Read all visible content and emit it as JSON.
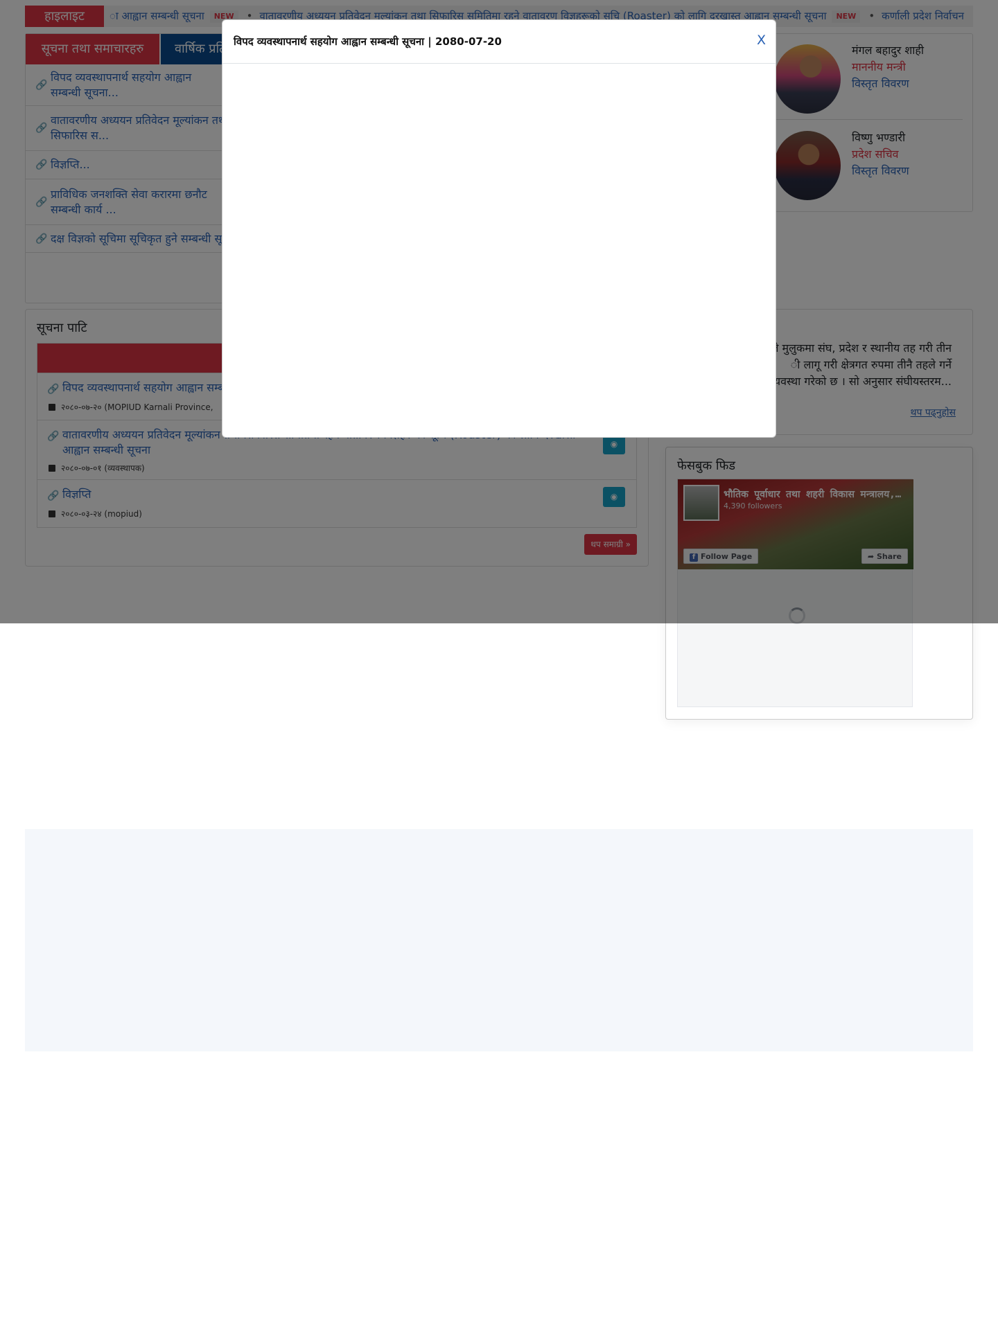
{
  "ticker": {
    "label": "हाइलाइट",
    "items": [
      {
        "text": "ा आह्वान सम्बन्धी सूचना",
        "badge": "NEW"
      },
      {
        "text": "वातावरणीय अध्ययन प्रतिवेदन मूल्यांकन तथा सिफारिस समितिमा रहने वातावरण विज्ञहरूको सूचि (Roaster) को लागि दरखास्त आह्वान सम्बन्धी सूचना",
        "badge": "NEW"
      },
      {
        "text": "कर्णाली प्रदेश निर्वाचन"
      }
    ]
  },
  "tabs": [
    {
      "label": "सूचना तथा समाचारहरु"
    },
    {
      "label": "वार्षिक प्रति"
    }
  ],
  "news": [
    {
      "text": "विपद व्यवस्थापनार्थ सहयोग आह्वान सम्बन्धी सूचना..."
    },
    {
      "text": "वातावरणीय अध्ययन प्रतिवेदन मूल्यांकन तथा सिफारिस स..."
    },
    {
      "text": "विज्ञप्ति..."
    },
    {
      "text": "प्राविधिक जनशक्ति सेवा करारमा छनौट सम्बन्धी कार्य ..."
    },
    {
      "text": "दक्ष विज्ञको सूचिमा सूचिकृत हुने सम्बन्धी सूचना"
    }
  ],
  "notice_board": {
    "title": "सूचना पाटि",
    "rows": [
      {
        "title": "विपद व्यवस्थापनार्थ सहयोग आह्वान सम्बन्धी सूचना",
        "meta": "२०८०-०७-२० (MOPIUD Karnali Province,"
      },
      {
        "title": "वातावरणीय अध्ययन प्रतिवेदन मूल्यांकन तथा सिफारिस समितिमा रहने वातावरण विज्ञहरूको सूचि (Roaster) को लागि दरखास्त आह्वान सम्बन्धी सूचना",
        "meta": "२०८०-०७-०१ (व्यवस्थापक)"
      },
      {
        "title": "विज्ञप्ति",
        "meta": "२०८०-०३-२४ (mopiud)"
      }
    ],
    "more_label": "थप समाग्री »"
  },
  "officials": [
    {
      "name": "मंगल बहादुर शाही",
      "role": "माननीय मन्त्री",
      "link": "विस्तृत विवरण"
    },
    {
      "name": "विष्णु भण्डारी",
      "role": "प्रदेश सचिव",
      "link": "विस्तृत विवरण"
    }
  ],
  "about": {
    "text": "ले मुलुकमा संघ, प्रदेश र स्थानीय तह गरी तीन\nी लागू गरी क्षेत्रगत रुपमा तीनै तहले गर्ने\nट व्यवस्था गरेको छ । सो अनुसार संघीयस्तरम...",
    "read_more": "थप पढ्नुहोस"
  },
  "facebook": {
    "title": "फेसबुक फिड",
    "page_name": "भौतिक पूर्वाधार तथा शहरी विकास मन्त्रालय, कर्णाली प्रदेश",
    "followers": "4,390 followers",
    "follow_label": "Follow Page",
    "share_label": "Share"
  },
  "modal": {
    "title": "विपद व्यवस्थापनार्थ सहयोग आह्वान सम्बन्धी सूचना | 2080-07-20",
    "close_label": "X"
  }
}
